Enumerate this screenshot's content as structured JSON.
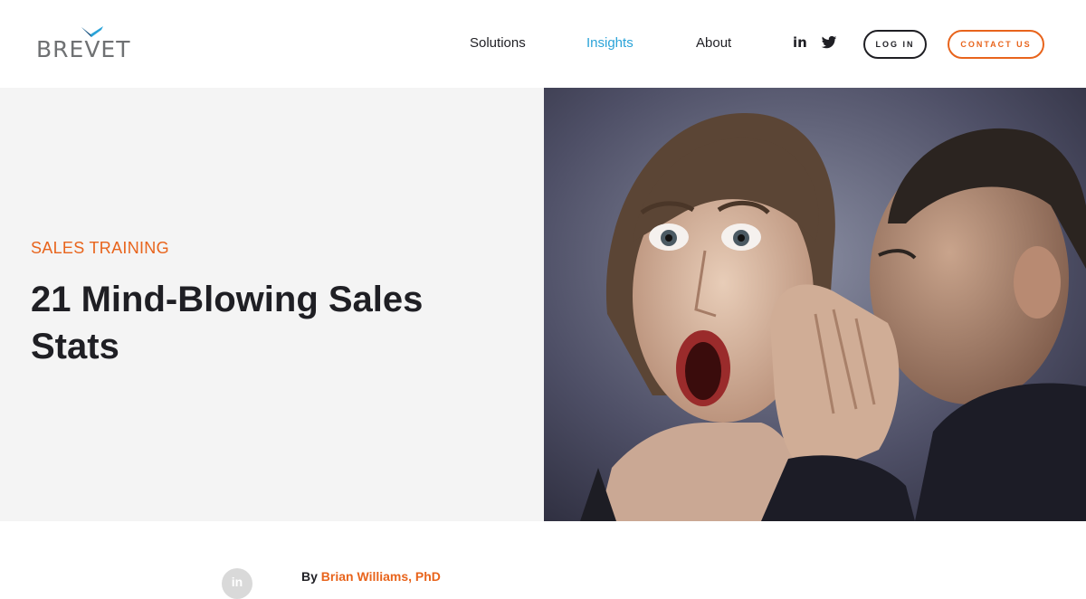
{
  "brand": {
    "name": "BREVET",
    "accent_orange": "#e8641c",
    "accent_blue": "#2aa3d8",
    "logo_mark_color": "#2aa3d8"
  },
  "nav": {
    "items": [
      {
        "label": "Solutions",
        "active": false
      },
      {
        "label": "Insights",
        "active": true
      },
      {
        "label": "About",
        "active": false
      }
    ],
    "social": [
      {
        "icon": "linkedin-icon",
        "glyph": "in"
      },
      {
        "icon": "twitter-icon"
      }
    ],
    "login_label": "LOG IN",
    "contact_label": "CONTACT US"
  },
  "article": {
    "category": "SALES TRAINING",
    "title": "21 Mind-Blowing Sales Stats",
    "byline_prefix": "By",
    "author": "Brian Williams, PhD",
    "author_avatar_glyph": "in",
    "hero_image_alt": "Man whispering a secret into a shocked woman's ear"
  }
}
